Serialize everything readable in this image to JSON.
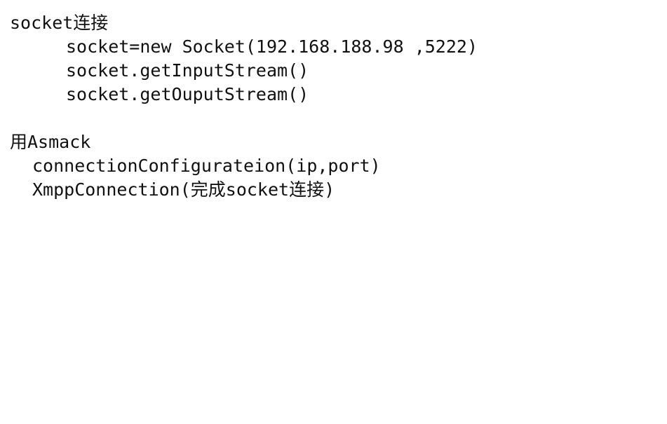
{
  "section1": {
    "heading": "socket连接",
    "lines": [
      "socket=new Socket(192.168.188.98 ,5222)",
      "socket.getInputStream()",
      "socket.getOuputStream()"
    ]
  },
  "section2": {
    "heading": "用Asmack",
    "lines": [
      "connectionConfigurateion(ip,port)",
      "XmppConnection(完成socket连接)"
    ]
  },
  "colors": {
    "text": "#111111",
    "background": "#ffffff"
  }
}
